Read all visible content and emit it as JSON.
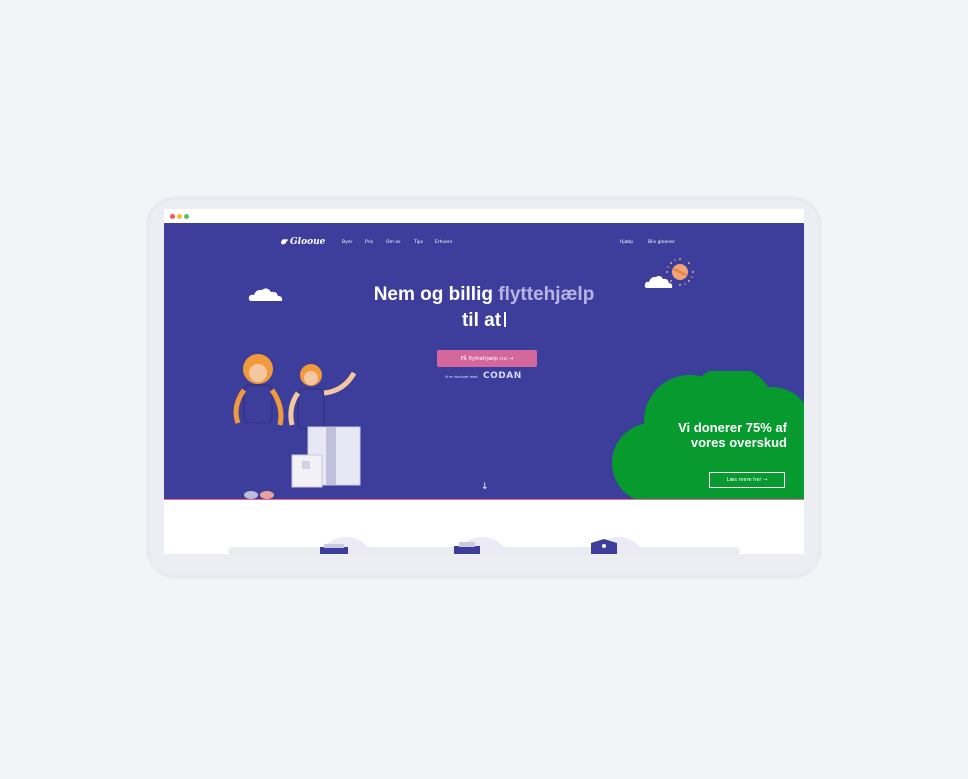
{
  "nav": {
    "logo": "Glooue",
    "items": [
      "Byer",
      "Pris",
      "Om os",
      "Tips",
      "Erhverv"
    ],
    "right_items": [
      "Hjælp",
      "Bliv glooner"
    ]
  },
  "hero": {
    "headline_prefix": "Nem og billig ",
    "headline_accent": "flyttehjælp",
    "headline_line2": "til at",
    "cta_label": "Få flyttehjælp nu →",
    "partner_text": "Vi er forsikret med",
    "partner_logo": "CODAN",
    "scroll_icon": "↓"
  },
  "donate": {
    "title": "Vi donerer 75% af vores overskud",
    "button_label": "Læs mere her →"
  },
  "colors": {
    "hero_bg": "#3d3e9b",
    "accent_pink": "#d4679b",
    "donate_green": "#069a2f"
  },
  "icons": [
    "cloud-icon",
    "sun-icon",
    "logo-bird-icon",
    "arrow-down-icon",
    "box-icon",
    "truck-icon",
    "shield-icon"
  ]
}
